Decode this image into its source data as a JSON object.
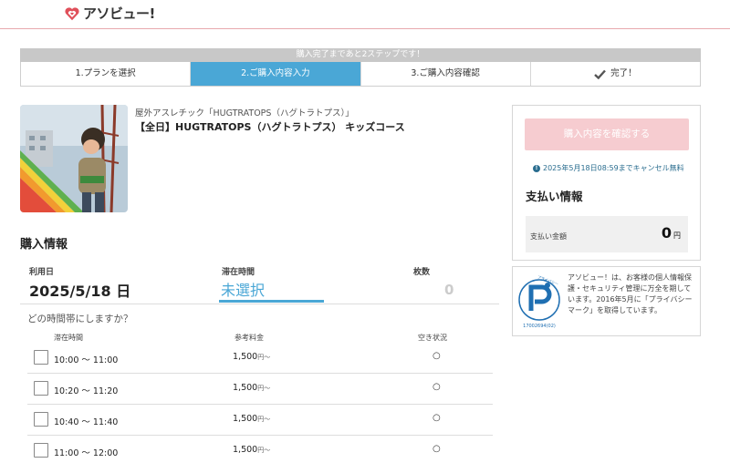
{
  "header": {
    "logo_text": "アソビュー!"
  },
  "progress": {
    "banner": "購入完了まであと2ステップです！",
    "steps": [
      {
        "label": "1.プランを選択"
      },
      {
        "label": "2.ご購入内容入力"
      },
      {
        "label": "3.ご購入内容確認"
      },
      {
        "label": "完了！"
      }
    ]
  },
  "product": {
    "subtitle": "屋外アスレチック「HUGTRATOPS（ハグトラトプス）」",
    "title": "【全日】HUGTRATOPS（ハグトラトプス） キッズコース"
  },
  "purchase": {
    "section_title": "購入情報",
    "date_label": "利用日",
    "date_value": "2025/5/18 日",
    "stay_label": "滞在時間",
    "stay_value": "未選択",
    "qty_label": "枚数",
    "qty_value": "0",
    "question": "どの時間帯にしますか？",
    "columns": {
      "time": "滞在時間",
      "price": "参考料金",
      "availability": "空き状況"
    },
    "rows": [
      {
        "time": "10:00 〜 11:00",
        "price": "1,500",
        "price_suffix": "円〜",
        "availability": "○"
      },
      {
        "time": "10:20 〜 11:20",
        "price": "1,500",
        "price_suffix": "円〜",
        "availability": "○"
      },
      {
        "time": "10:40 〜 11:40",
        "price": "1,500",
        "price_suffix": "円〜",
        "availability": "○"
      },
      {
        "time": "11:00 〜 12:00",
        "price": "1,500",
        "price_suffix": "円〜",
        "availability": "○"
      }
    ]
  },
  "sidebar": {
    "confirm_button": "購入内容を確認する",
    "cancel_note": "2025年5月18日08:59までキャンセル無料",
    "payment_title": "支払い情報",
    "payment_label": "支払い金額",
    "payment_amount": "0",
    "payment_unit": "円"
  },
  "privacy": {
    "text": "アソビュー！は、お客様の個人情報保護・セキュリティ管理に万全を期しています。2016年5月に「プライバシーマーク」を取得しています。",
    "mark_number": "17002694(02)",
    "mark_label": "プライバシー"
  },
  "colors": {
    "accent": "#4aa7d6",
    "brand": "#e0505a",
    "button_disabled": "#f6ccd0"
  }
}
